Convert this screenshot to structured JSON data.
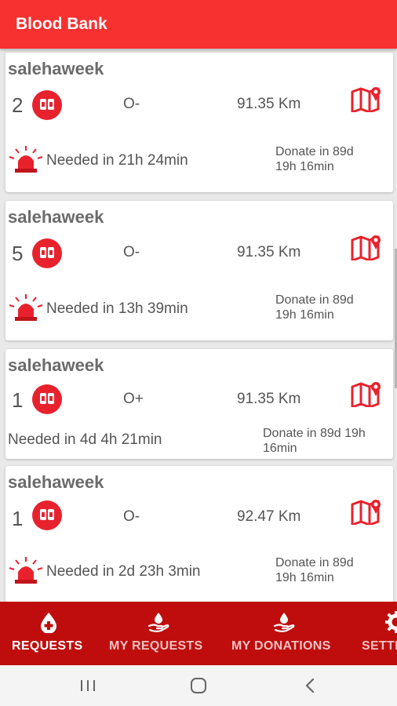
{
  "app": {
    "title": "Blood Bank"
  },
  "requests": [
    {
      "name": "salehaweek",
      "count": "2",
      "blood_type": "O-",
      "distance": "91.35 Km",
      "urgent": true,
      "needed": "Needed in 21h 24min",
      "donate_line1": "Donate in 89d",
      "donate_line2": "19h 16min"
    },
    {
      "name": "salehaweek",
      "count": "5",
      "blood_type": "O-",
      "distance": "91.35 Km",
      "urgent": true,
      "needed": "Needed in 13h 39min",
      "donate_line1": "Donate in 89d",
      "donate_line2": "19h 16min"
    },
    {
      "name": "salehaweek",
      "count": "1",
      "blood_type": "O+",
      "distance": "91.35 Km",
      "urgent": false,
      "needed": "Needed in 4d 4h 21min",
      "donate_line1": "Donate in 89d 19h",
      "donate_line2": "16min"
    },
    {
      "name": "salehaweek",
      "count": "1",
      "blood_type": "O-",
      "distance": "92.47 Km",
      "urgent": true,
      "needed": "Needed in 2d 23h 3min",
      "donate_line1": "Donate in 89d",
      "donate_line2": "19h 16min"
    }
  ],
  "bottom_nav": [
    {
      "label": "REQUESTS",
      "icon": "blood-drop-plus-icon",
      "active": true
    },
    {
      "label": "MY REQUESTS",
      "icon": "hand-drop-icon",
      "active": false
    },
    {
      "label": "MY DONATIONS",
      "icon": "hand-drop-icon",
      "active": false
    },
    {
      "label": "SETTINGS",
      "icon": "gear-icon",
      "active": false
    }
  ],
  "system_nav": [
    "recent-apps-icon",
    "home-icon",
    "back-icon"
  ],
  "colors": {
    "appbar": "#f73030",
    "bottom_nav": "#bf0d0d",
    "accent": "#e8222d"
  }
}
